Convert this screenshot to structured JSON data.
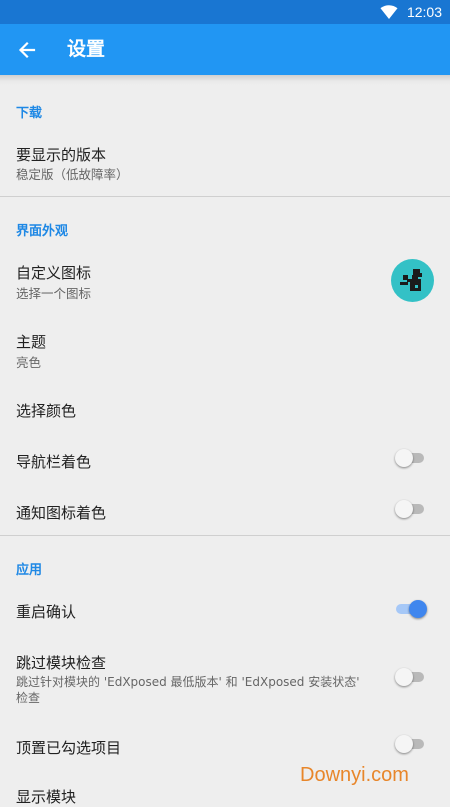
{
  "status_bar": {
    "time": "12:03",
    "wifi_icon": "wifi-icon"
  },
  "app_bar": {
    "title": "设置",
    "back_icon": "arrow-back-icon"
  },
  "sections": {
    "download": {
      "header": "下载",
      "version": {
        "title": "要显示的版本",
        "subtitle": "稳定版（低故障率）"
      }
    },
    "appearance": {
      "header": "界面外观",
      "custom_icon": {
        "title": "自定义图标",
        "subtitle": "选择一个图标",
        "icon": "app-puzzle-icon"
      },
      "theme": {
        "title": "主题",
        "subtitle": "亮色"
      },
      "pick_color": {
        "title": "选择颜色"
      },
      "nav_bar_tint": {
        "title": "导航栏着色",
        "enabled": false
      },
      "notif_icon_tint": {
        "title": "通知图标着色",
        "enabled": false
      }
    },
    "app": {
      "header": "应用",
      "reboot_confirm": {
        "title": "重启确认",
        "enabled": true
      },
      "skip_module_check": {
        "title": "跳过模块检查",
        "subtitle_line1": "跳过针对模块的 'EdXposed 最低版本' 和 'EdXposed 安装状态'",
        "subtitle_line2": "检查",
        "enabled": false
      },
      "pin_checked": {
        "title": "顶置已勾选项目",
        "enabled": false
      },
      "show_modules": {
        "title": "显示模块"
      }
    }
  },
  "watermark": "Downyi.com",
  "colors": {
    "status_bar": "#1976d2",
    "app_bar": "#2196f3",
    "accent": "#1e88e5",
    "switch_on": "#3f86ee",
    "icon_bg": "#33c1c6",
    "watermark": "#e8862a"
  }
}
